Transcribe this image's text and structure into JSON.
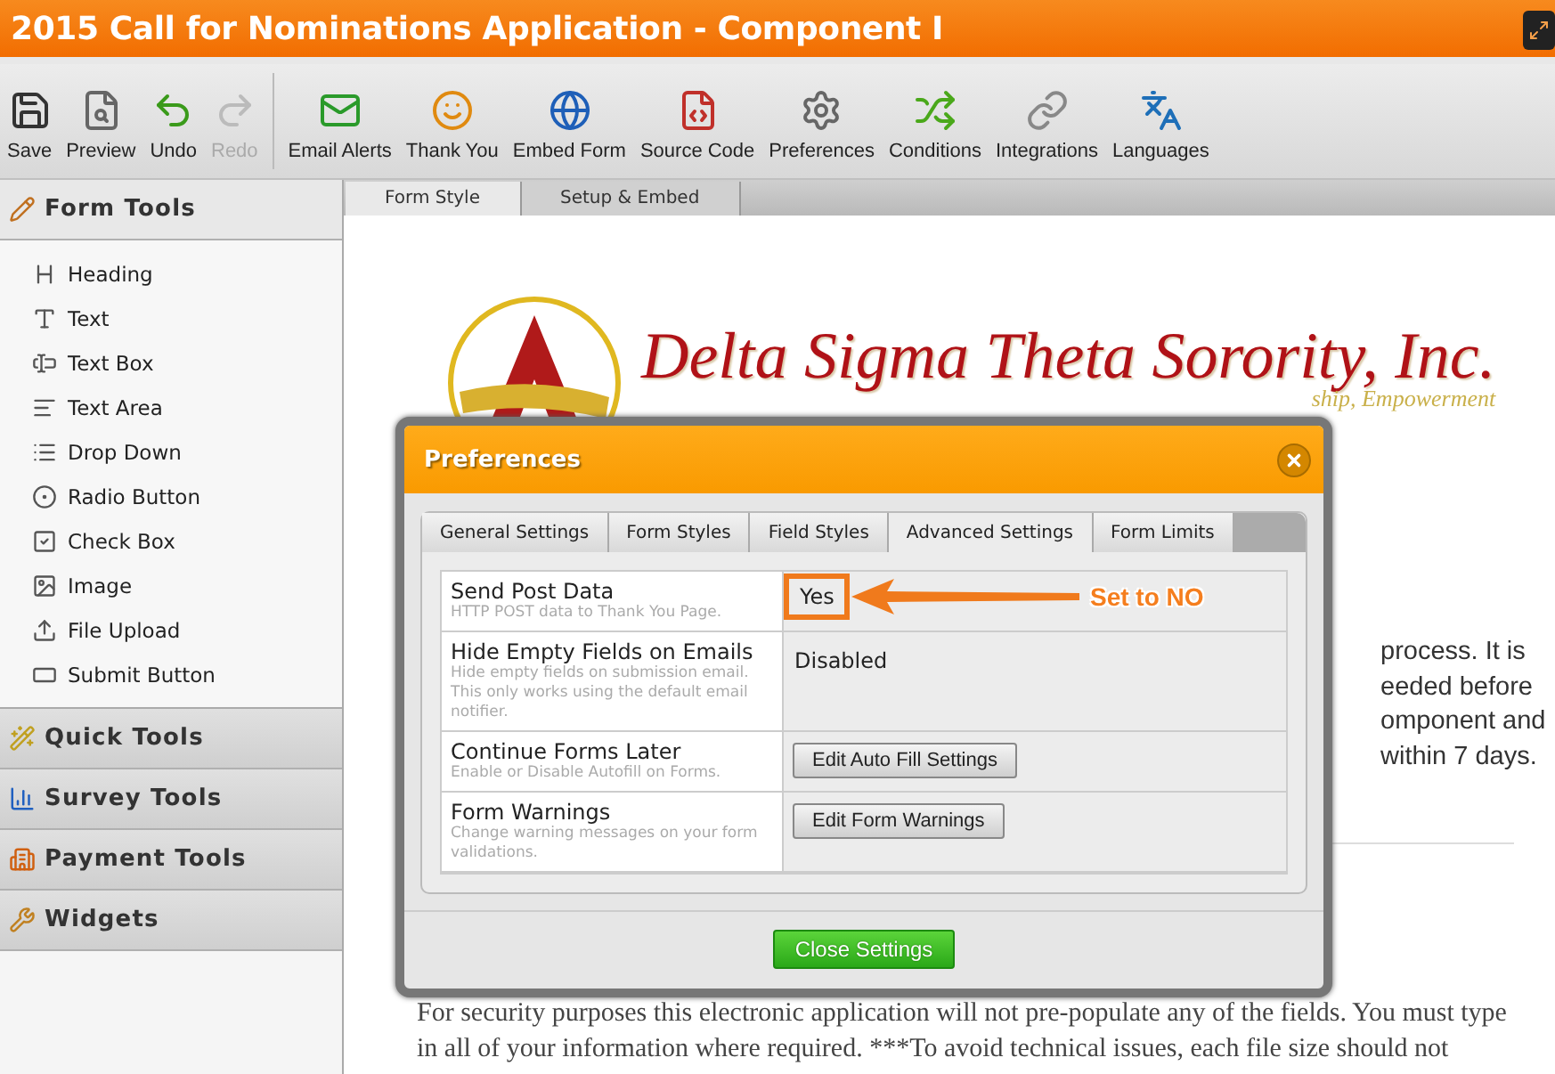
{
  "window": {
    "title": "2015 Call for Nominations Application - Component I"
  },
  "toolbar": {
    "items": [
      {
        "label": "Save",
        "disabled": false
      },
      {
        "label": "Preview",
        "disabled": false
      },
      {
        "label": "Undo",
        "disabled": false
      },
      {
        "label": "Redo",
        "disabled": true
      },
      {
        "label": "Email Alerts",
        "disabled": false
      },
      {
        "label": "Thank You",
        "disabled": false
      },
      {
        "label": "Embed Form",
        "disabled": false
      },
      {
        "label": "Source Code",
        "disabled": false
      },
      {
        "label": "Preferences",
        "disabled": false
      },
      {
        "label": "Conditions",
        "disabled": false
      },
      {
        "label": "Integrations",
        "disabled": false
      },
      {
        "label": "Languages",
        "disabled": false
      }
    ]
  },
  "sidebar": {
    "sections": [
      {
        "title": "Form Tools",
        "expanded": true,
        "items": [
          {
            "label": "Heading"
          },
          {
            "label": "Text"
          },
          {
            "label": "Text Box"
          },
          {
            "label": "Text Area"
          },
          {
            "label": "Drop Down"
          },
          {
            "label": "Radio Button"
          },
          {
            "label": "Check Box"
          },
          {
            "label": "Image"
          },
          {
            "label": "File Upload"
          },
          {
            "label": "Submit Button"
          }
        ]
      },
      {
        "title": "Quick Tools",
        "expanded": false
      },
      {
        "title": "Survey Tools",
        "expanded": false
      },
      {
        "title": "Payment Tools",
        "expanded": false
      },
      {
        "title": "Widgets",
        "expanded": false
      }
    ]
  },
  "editor_tabs": [
    {
      "label": "Form Style",
      "selected": true
    },
    {
      "label": "Setup & Embed",
      "selected": false
    }
  ],
  "form": {
    "logo": {
      "title": "Delta Sigma Theta Sorority, Inc.",
      "tagline": "ship, Empowerment"
    },
    "intro_fragments": [
      "process. It is",
      "eeded before",
      "omponent and",
      "within 7 days."
    ],
    "paragraph": "For security purposes this electronic application will not pre-populate any of the fields. You must type in all of your information where required. ***To avoid technical issues, each file size should not"
  },
  "dialog": {
    "title": "Preferences",
    "tabs": [
      {
        "label": "General Settings",
        "selected": false
      },
      {
        "label": "Form Styles",
        "selected": false
      },
      {
        "label": "Field Styles",
        "selected": false
      },
      {
        "label": "Advanced Settings",
        "selected": true
      },
      {
        "label": "Form Limits",
        "selected": false
      }
    ],
    "settings": [
      {
        "label": "Send Post Data",
        "description": "HTTP POST data to Thank You Page.",
        "kind": "text",
        "value": "Yes",
        "highlighted": true
      },
      {
        "label": "Hide Empty Fields on Emails",
        "description": "Hide empty fields on submission email. This only works using the default email notifier.",
        "kind": "text",
        "value": "Disabled",
        "highlighted": false
      },
      {
        "label": "Continue Forms Later",
        "description": "Enable or Disable Autofill on Forms.",
        "kind": "button",
        "value": "Edit Auto Fill Settings",
        "highlighted": false
      },
      {
        "label": "Form Warnings",
        "description": "Change warning messages on your form validations.",
        "kind": "button",
        "value": "Edit Form Warnings",
        "highlighted": false
      }
    ],
    "annotation": "Set to NO",
    "close_button": "Close Settings"
  }
}
